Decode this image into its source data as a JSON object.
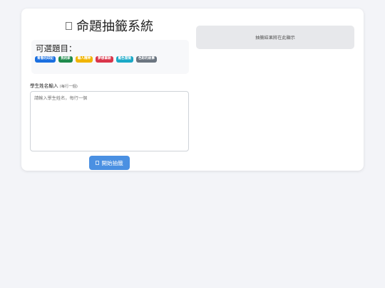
{
  "header": {
    "title": "命題抽籤系統",
    "icon": "document-icon"
  },
  "topics": {
    "label": "可選題目：",
    "items": [
      {
        "label": "青春的印記",
        "color": "#1a6fe0"
      },
      {
        "label": "我的家",
        "color": "#1e8a4c"
      },
      {
        "label": "職人精神",
        "color": "#f0b400"
      },
      {
        "label": "夢想筆跡",
        "color": "#d9354a"
      },
      {
        "label": "藍色冒險",
        "color": "#1aa9c7"
      },
      {
        "label": "色彩的故事",
        "color": "#6b7580"
      }
    ]
  },
  "form": {
    "label": "學生姓名輸入",
    "hint": "(每行一個)",
    "placeholder": "請輸入學生姓名，每行一個"
  },
  "actions": {
    "start_label": "開始抽籤",
    "start_icon": "shuffle-icon"
  },
  "result": {
    "text": "抽籤結果將在此顯示"
  }
}
